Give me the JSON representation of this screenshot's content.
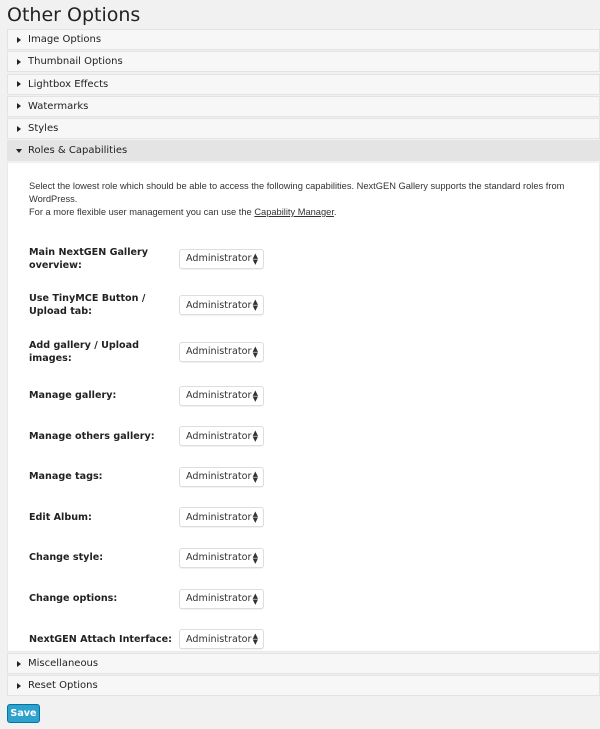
{
  "title": "Other Options",
  "sections_before": [
    "Image Options",
    "Thumbnail Options",
    "Lightbox Effects",
    "Watermarks",
    "Styles"
  ],
  "open_section": "Roles & Capabilities",
  "intro": {
    "line1": "Select the lowest role which should be able to access the following capabilities. NextGEN Gallery supports the standard roles from WordPress.",
    "line2_prefix": "For a more flexible user management you can use the ",
    "link": "Capability Manager",
    "line2_suffix": "."
  },
  "roles": [
    {
      "label": "Main NextGEN Gallery overview:",
      "value": "Administrator"
    },
    {
      "label": "Use TinyMCE Button / Upload tab:",
      "value": "Administrator"
    },
    {
      "label": "Add gallery / Upload images:",
      "value": "Administrator"
    },
    {
      "label": "Manage gallery:",
      "value": "Administrator"
    },
    {
      "label": "Manage others gallery:",
      "value": "Administrator"
    },
    {
      "label": "Manage tags:",
      "value": "Administrator"
    },
    {
      "label": "Edit Album:",
      "value": "Administrator"
    },
    {
      "label": "Change style:",
      "value": "Administrator"
    },
    {
      "label": "Change options:",
      "value": "Administrator"
    },
    {
      "label": "NextGEN Attach Interface:",
      "value": "Administrator"
    }
  ],
  "sections_after": [
    "Miscellaneous",
    "Reset Options"
  ],
  "save_label": "Save"
}
